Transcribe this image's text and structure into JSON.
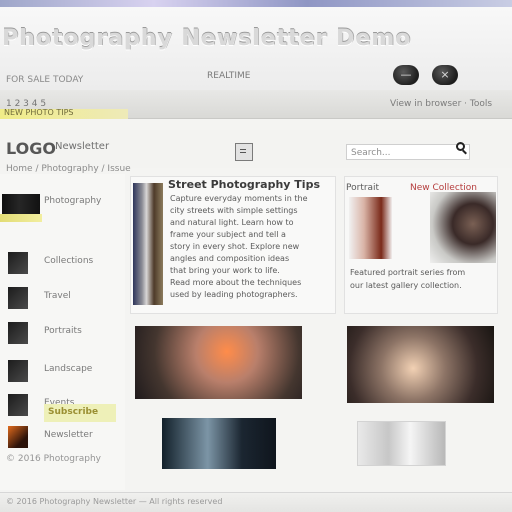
{
  "window": {
    "title": "Photography Newsletter Demo",
    "colors": {
      "top_strip": "#9ea6c9",
      "accent_yellow": "#f0ec88",
      "tag_red": "#b53d3d"
    }
  },
  "header": {
    "small_left": "FOR SALE TODAY",
    "small_mid": "REALTIME",
    "minimize_icon": "—",
    "close_icon": "×"
  },
  "toolbar": {
    "left_text": "1     2     3     4     5",
    "right_text": "View in browser  ·  Tools",
    "yellow_label": "NEW PHOTO TIPS"
  },
  "nav": {
    "logo": "LOGO",
    "menu_label": "Newsletter",
    "search_placeholder": "Search..."
  },
  "breadcrumb": "Home / Photography / Issue",
  "sidebar": {
    "items": [
      {
        "label": "Photography"
      },
      {
        "label": "Collections"
      },
      {
        "label": "Travel"
      },
      {
        "label": "Portraits"
      },
      {
        "label": "Landscape"
      },
      {
        "label": "Events"
      },
      {
        "label": "Newsletter"
      }
    ],
    "highlight_label": "Subscribe",
    "footer": "© 2016 Photography"
  },
  "main": {
    "panel1": {
      "heading": "Street Photography Tips",
      "lines": [
        "Capture everyday moments in the",
        "city streets with simple settings",
        "and natural light. Learn how to",
        "frame your subject and tell a",
        "story in every shot. Explore new",
        "angles and composition ideas",
        "that bring your work to life.",
        "Read more about the techniques",
        "used by leading photographers."
      ]
    },
    "panel2": {
      "header": "Portrait",
      "tag": "New Collection",
      "caption": [
        "Featured portrait series from",
        "our latest gallery collection."
      ]
    },
    "media": [
      {
        "name": "media-orange-scene"
      },
      {
        "name": "media-portrait-group"
      },
      {
        "name": "media-blue-scene"
      },
      {
        "name": "media-light-scene"
      }
    ]
  },
  "bottom": {
    "text": "© 2016 Photography Newsletter — All rights reserved"
  }
}
